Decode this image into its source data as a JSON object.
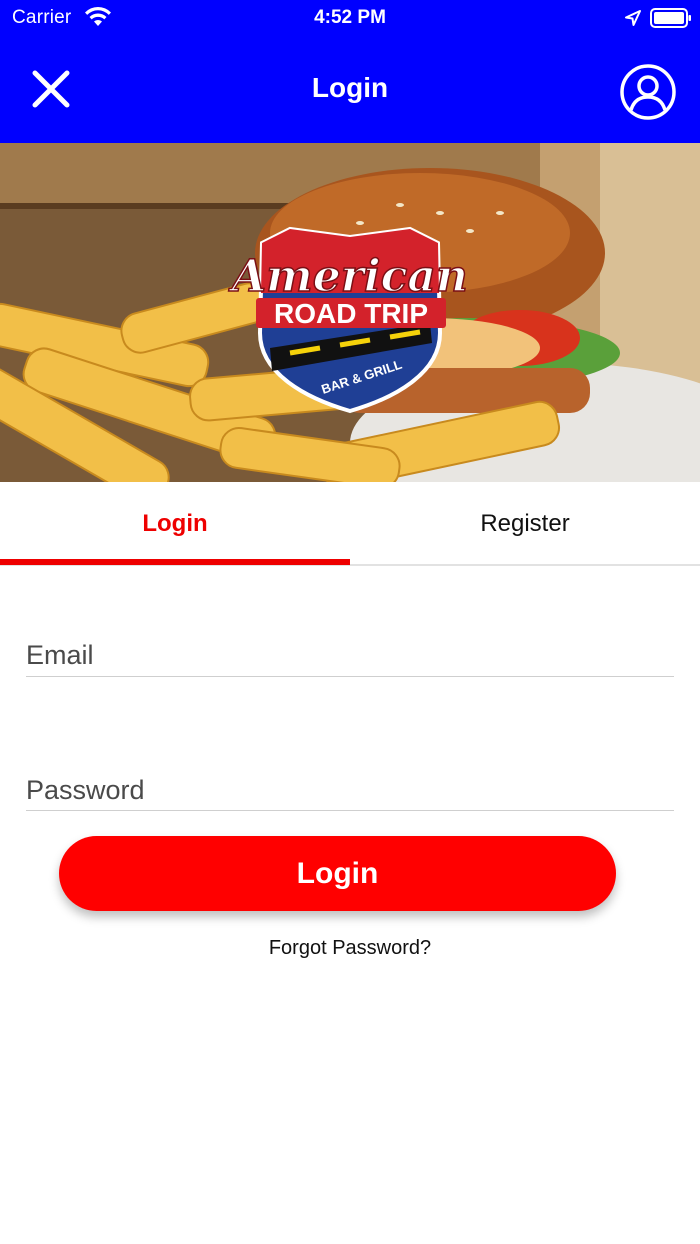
{
  "status_bar": {
    "carrier": "Carrier",
    "time": "4:52 PM",
    "icons": [
      "wifi-icon",
      "location-arrow-icon",
      "battery-icon"
    ]
  },
  "nav": {
    "title": "Login",
    "close_icon": "close-icon",
    "profile_icon": "user-profile-icon",
    "background": "#0000ff"
  },
  "hero": {
    "logo_text_top": "American",
    "logo_text_main": "ROAD TRIP",
    "logo_text_sub": "BAR & GRILL"
  },
  "tabs": [
    {
      "label": "Login",
      "active": true
    },
    {
      "label": "Register",
      "active": false
    }
  ],
  "form": {
    "email_placeholder": "Email",
    "email_value": "",
    "password_placeholder": "Password",
    "password_value": "",
    "login_button": "Login",
    "forgot_password": "Forgot Password?"
  },
  "colors": {
    "accent": "#ff0000",
    "nav_bg": "#0000ff"
  }
}
